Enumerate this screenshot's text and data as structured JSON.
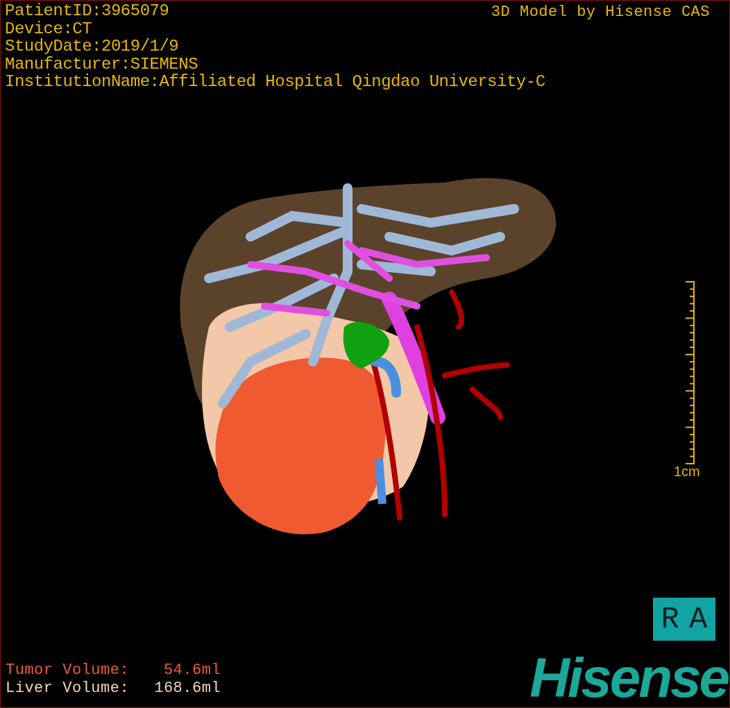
{
  "header": {
    "info_lines": [
      "PatientID:3965079",
      "Device:CT",
      "StudyDate:2019/1/9",
      "Manufacturer:SIEMENS",
      "InstitutionName:Affiliated Hospital Qingdao University-C"
    ],
    "credit": "3D Model by Hisense CAS"
  },
  "scale_bar": {
    "label": "1cm"
  },
  "orientation_badge": "RA",
  "volumes": [
    {
      "kind": "tumor",
      "label": "Tumor Volume:",
      "value": "  54.6ml"
    },
    {
      "kind": "liver",
      "label": "Liver Volume:",
      "value": "168.6ml"
    }
  ],
  "logo": "Hisense"
}
